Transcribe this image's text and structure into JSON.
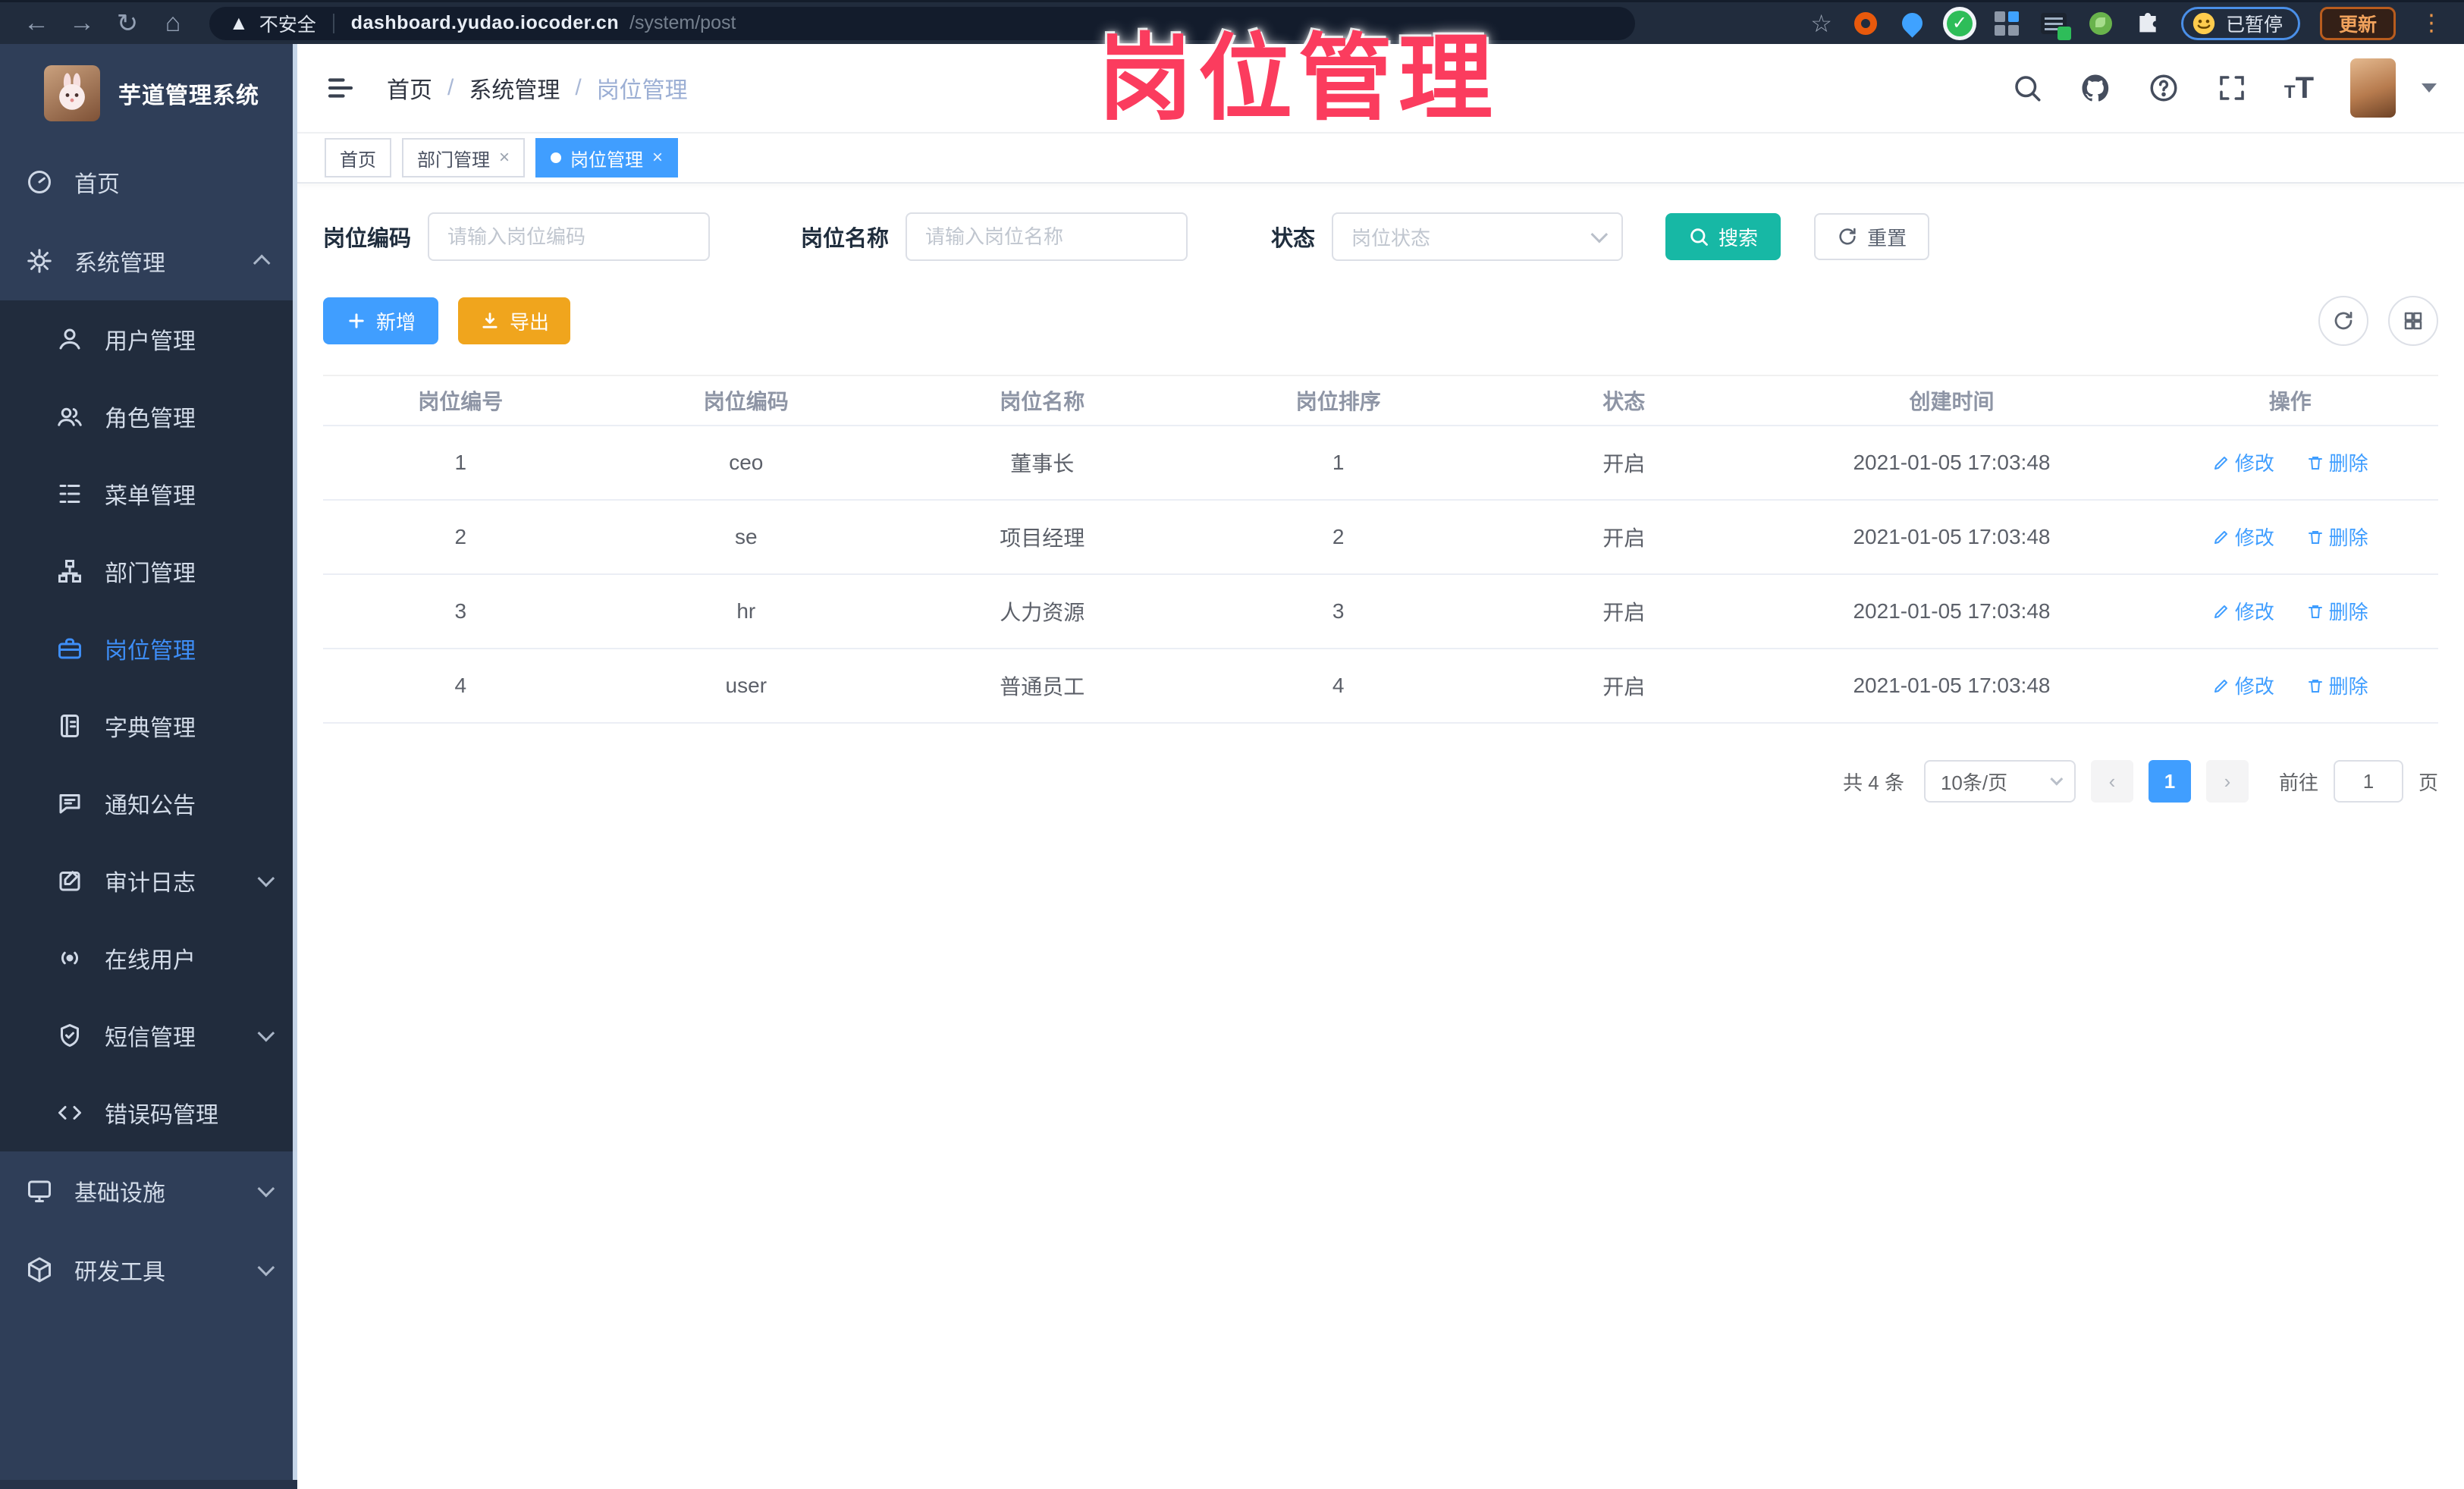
{
  "overlay": {
    "title": "岗位管理"
  },
  "browser": {
    "security": "不安全",
    "url_domain": "dashboard.yudao.iocoder.cn",
    "url_path": "/system/post",
    "paused_badge": "已暂停",
    "update_button": "更新"
  },
  "sidebar": {
    "logo_title": "芋道管理系统",
    "home_label": "首页",
    "system_label": "系统管理",
    "system_children": [
      {
        "label": "用户管理"
      },
      {
        "label": "角色管理"
      },
      {
        "label": "菜单管理"
      },
      {
        "label": "部门管理"
      },
      {
        "label": "岗位管理"
      },
      {
        "label": "字典管理"
      },
      {
        "label": "通知公告"
      },
      {
        "label": "审计日志"
      },
      {
        "label": "在线用户"
      },
      {
        "label": "短信管理"
      },
      {
        "label": "错误码管理"
      }
    ],
    "infra_label": "基础设施",
    "devtools_label": "研发工具"
  },
  "header": {
    "breadcrumb": [
      "首页",
      "系统管理",
      "岗位管理"
    ],
    "separator": "/"
  },
  "tabs": [
    {
      "label": "首页"
    },
    {
      "label": "部门管理"
    },
    {
      "label": "岗位管理"
    }
  ],
  "filters": {
    "code_label": "岗位编码",
    "code_placeholder": "请输入岗位编码",
    "name_label": "岗位名称",
    "name_placeholder": "请输入岗位名称",
    "status_label": "状态",
    "status_placeholder": "岗位状态",
    "search": "搜索",
    "reset": "重置"
  },
  "toolbar": {
    "add": "新增",
    "export": "导出"
  },
  "table": {
    "columns": [
      "岗位编号",
      "岗位编码",
      "岗位名称",
      "岗位排序",
      "状态",
      "创建时间",
      "操作"
    ],
    "edit": "修改",
    "delete": "删除",
    "rows": [
      {
        "id": "1",
        "code": "ceo",
        "name": "董事长",
        "sort": "1",
        "status": "开启",
        "created": "2021-01-05 17:03:48"
      },
      {
        "id": "2",
        "code": "se",
        "name": "项目经理",
        "sort": "2",
        "status": "开启",
        "created": "2021-01-05 17:03:48"
      },
      {
        "id": "3",
        "code": "hr",
        "name": "人力资源",
        "sort": "3",
        "status": "开启",
        "created": "2021-01-05 17:03:48"
      },
      {
        "id": "4",
        "code": "user",
        "name": "普通员工",
        "sort": "4",
        "status": "开启",
        "created": "2021-01-05 17:03:48"
      }
    ]
  },
  "pagination": {
    "total": "共 4 条",
    "page_size": "10条/页",
    "page": "1",
    "goto": "前往",
    "goto_value": "1",
    "unit": "页"
  },
  "colors": {
    "accent": "#409eff",
    "search_teal": "#17b8a5",
    "export_amber": "#f0a51d",
    "sidebar_bg": "#2f3e58",
    "submenu_bg": "#212c3d",
    "overlay_pink": "#fb3c5e"
  }
}
